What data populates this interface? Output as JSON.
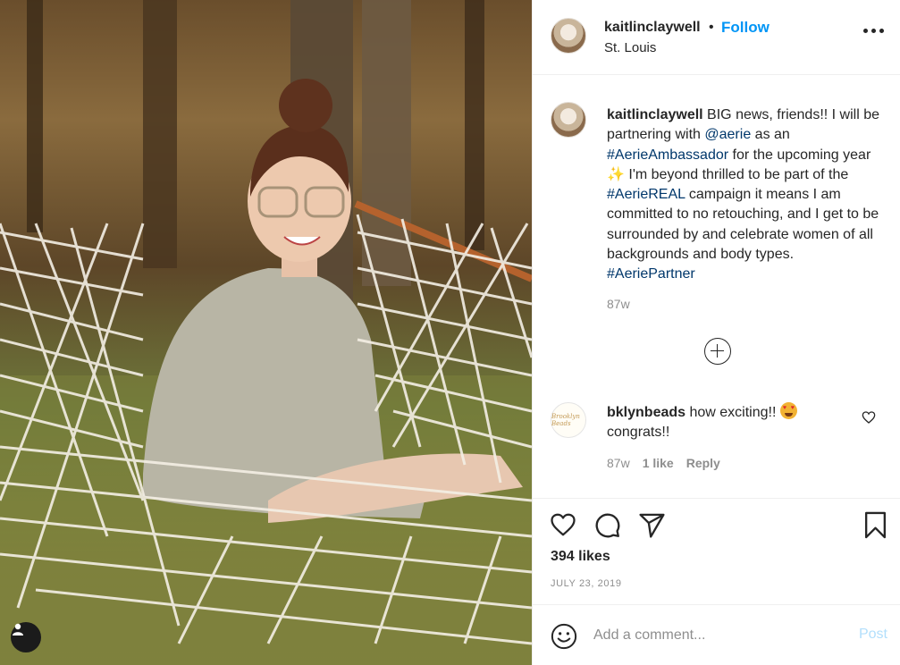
{
  "photo": {
    "description_icon": "user-tag-icon"
  },
  "header": {
    "username": "kaitlinclaywell",
    "separator": "•",
    "follow_label": "Follow",
    "location": "St. Louis",
    "more_icon": "more-options-icon"
  },
  "caption": {
    "username": "kaitlinclaywell",
    "segments": [
      {
        "text": " BIG news, friends!! I will be partnering with ",
        "type": "text"
      },
      {
        "text": "@aerie",
        "type": "tag"
      },
      {
        "text": " as an ",
        "type": "text"
      },
      {
        "text": "#AerieAmbassador",
        "type": "tag"
      },
      {
        "text": " for the upcoming year ✨ I'm beyond thrilled to be part of the ",
        "type": "text"
      },
      {
        "text": "#AerieREAL",
        "type": "tag"
      },
      {
        "text": " campaign it means I am committed to no retouching, and I get to be surrounded by and celebrate women of all backgrounds and body types. ",
        "type": "text"
      },
      {
        "text": "#AeriePartner",
        "type": "tag"
      }
    ],
    "time": "87w"
  },
  "load_more_icon": "plus-circle-icon",
  "comment": {
    "username": "bklynbeads",
    "text": " how exciting!! ",
    "text_after": "congrats!!",
    "emoji": "heart-eyes-emoji",
    "avatar_text": "Brooklyn Beads",
    "time": "87w",
    "likes": "1 like",
    "reply_label": "Reply"
  },
  "actions": {
    "icons": [
      "heart-icon",
      "comment-icon",
      "share-icon",
      "bookmark-icon"
    ]
  },
  "likes_text": "394 likes",
  "date_text": "JULY 23, 2019",
  "add_comment": {
    "placeholder": "Add a comment...",
    "post_label": "Post"
  },
  "colors": {
    "accent": "#0095f6",
    "hashtag": "#00376b",
    "muted": "#8e8e8e",
    "post_disabled": "#b2dffc"
  }
}
